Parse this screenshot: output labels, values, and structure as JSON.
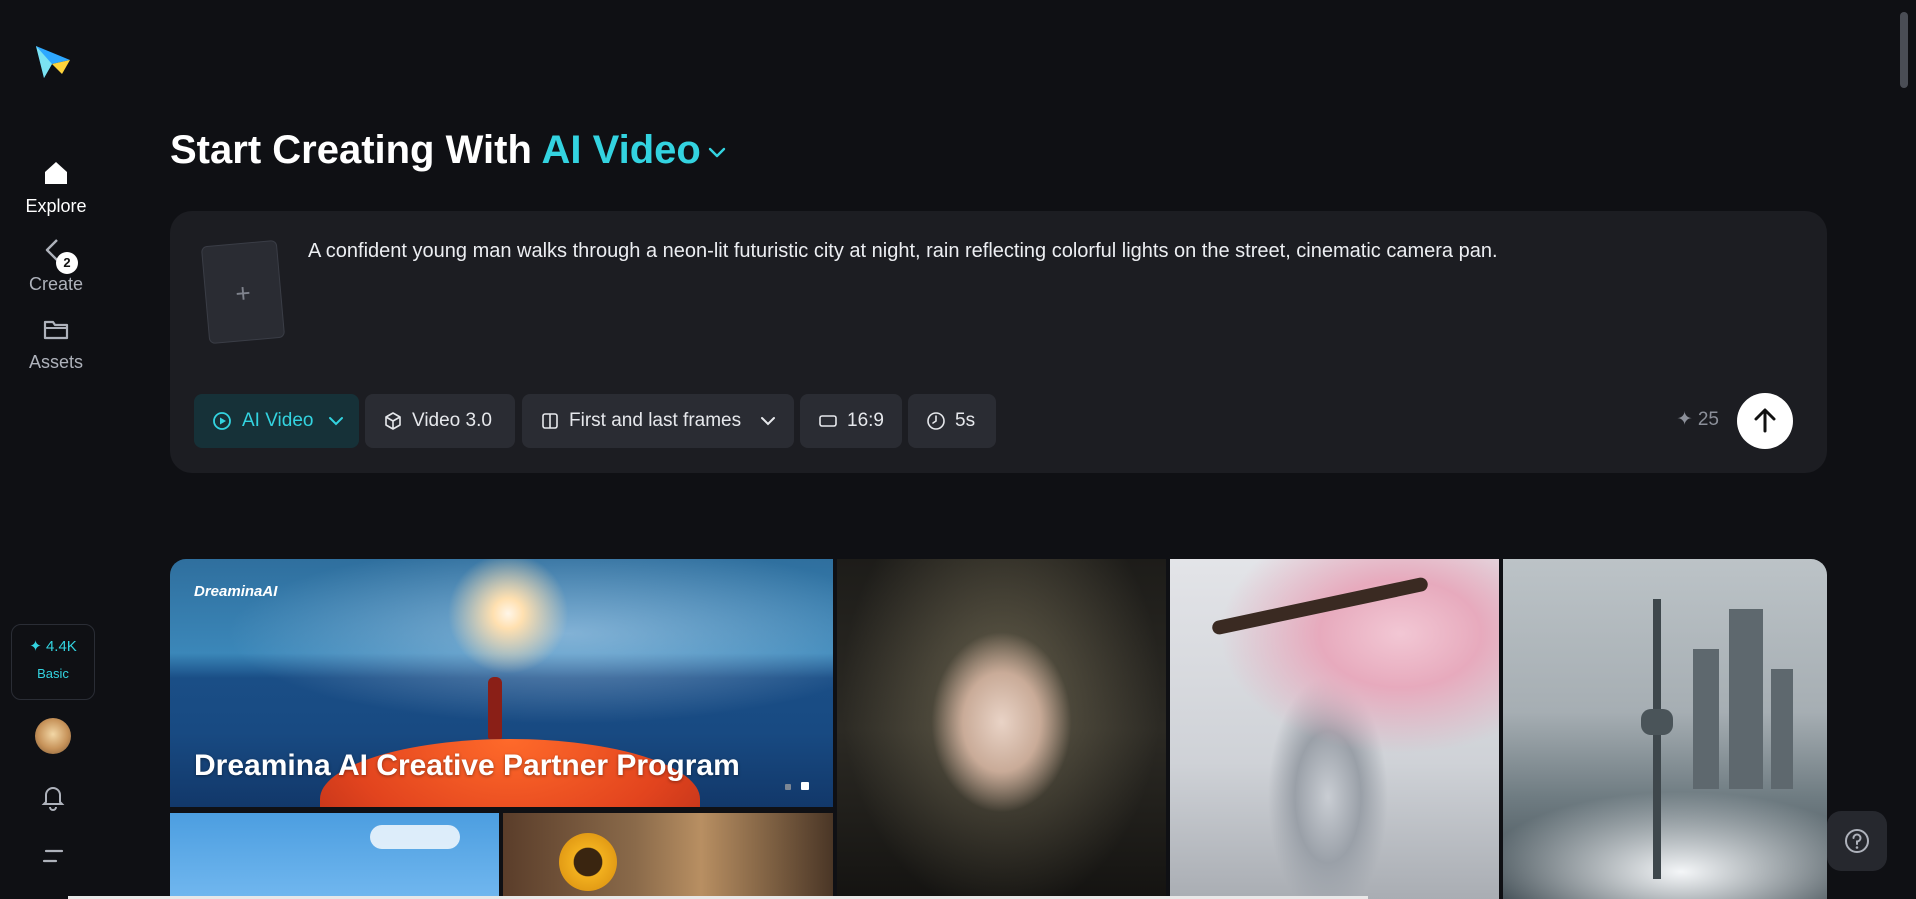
{
  "sidebar": {
    "nav": [
      {
        "label": "Explore",
        "icon": "home-icon",
        "active": true
      },
      {
        "label": "Create",
        "icon": "create-icon",
        "badge": "2"
      },
      {
        "label": "Assets",
        "icon": "folder-icon"
      }
    ],
    "credits": {
      "value": "✦ 4.4K",
      "tier": "Basic"
    }
  },
  "header": {
    "title_prefix": "Start Creating With",
    "title_accent": "AI Video"
  },
  "prompt": {
    "text": "A confident young man walks through a neon-lit futuristic city at night, rain reflecting colorful lights on the street, cinematic camera pan.",
    "upload_plus": "+"
  },
  "options": {
    "mode": "AI Video",
    "model": "Video 3.0",
    "frames": "First and last frames",
    "ratio": "16:9",
    "duration": "5s"
  },
  "cost": "✦ 25",
  "gallery": {
    "banner_brand": "DreaminaAI",
    "banner_title": "Dreamina AI Creative Partner Program"
  },
  "colors": {
    "accent": "#33d3e0",
    "background": "#0f1014",
    "card": "#1c1d22",
    "chip": "#2a2c33"
  }
}
